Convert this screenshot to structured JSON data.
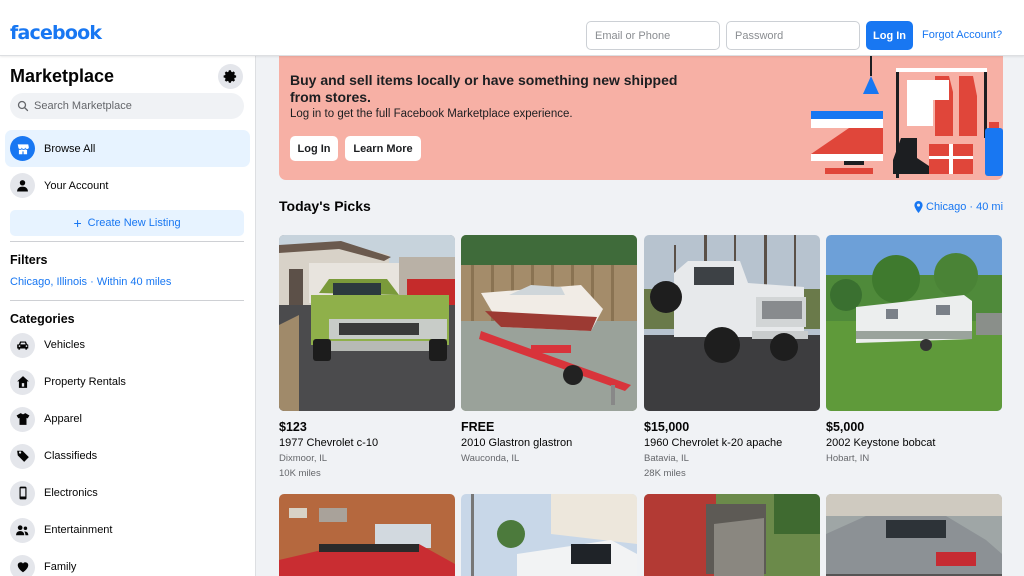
{
  "header": {
    "logo": "facebook",
    "email_placeholder": "Email or Phone",
    "password_placeholder": "Password",
    "login_label": "Log In",
    "forgot_label": "Forgot Account?"
  },
  "sidebar": {
    "title": "Marketplace",
    "search_placeholder": "Search Marketplace",
    "nav": [
      {
        "label": "Browse All",
        "icon": "storefront-icon",
        "active": true
      },
      {
        "label": "Your Account",
        "icon": "person-icon",
        "active": false
      }
    ],
    "create_listing": "Create New Listing",
    "filters_title": "Filters",
    "filter_location": "Chicago, Illinois · Within 40 miles",
    "categories_title": "Categories",
    "categories": [
      {
        "label": "Vehicles",
        "icon": "car-icon"
      },
      {
        "label": "Property Rentals",
        "icon": "house-icon"
      },
      {
        "label": "Apparel",
        "icon": "shirt-icon"
      },
      {
        "label": "Classifieds",
        "icon": "tag-icon"
      },
      {
        "label": "Electronics",
        "icon": "phone-icon"
      },
      {
        "label": "Entertainment",
        "icon": "people-icon"
      },
      {
        "label": "Family",
        "icon": "heart-icon"
      }
    ]
  },
  "banner": {
    "title": "Buy and sell items locally or have something new shipped from stores.",
    "subtitle": "Log in to get the full Facebook Marketplace experience.",
    "login_label": "Log In",
    "learn_label": "Learn More"
  },
  "picks": {
    "title": "Today's Picks",
    "location": "Chicago · 40 mi",
    "listings": [
      {
        "price": "$123",
        "title": "1977 Chevrolet c-10",
        "location": "Dixmoor, IL",
        "miles": "10K miles"
      },
      {
        "price": "FREE",
        "title": "2010 Glastron glastron",
        "location": "Wauconda, IL",
        "miles": ""
      },
      {
        "price": "$15,000",
        "title": "1960 Chevrolet k-20 apache",
        "location": "Batavia, IL",
        "miles": "28K miles"
      },
      {
        "price": "$5,000",
        "title": "2002 Keystone bobcat",
        "location": "Hobart, IN",
        "miles": ""
      }
    ]
  },
  "colors": {
    "brand": "#1877f2",
    "banner_bg": "#f7b0a5",
    "active_nav_bg": "#e7f3ff"
  }
}
